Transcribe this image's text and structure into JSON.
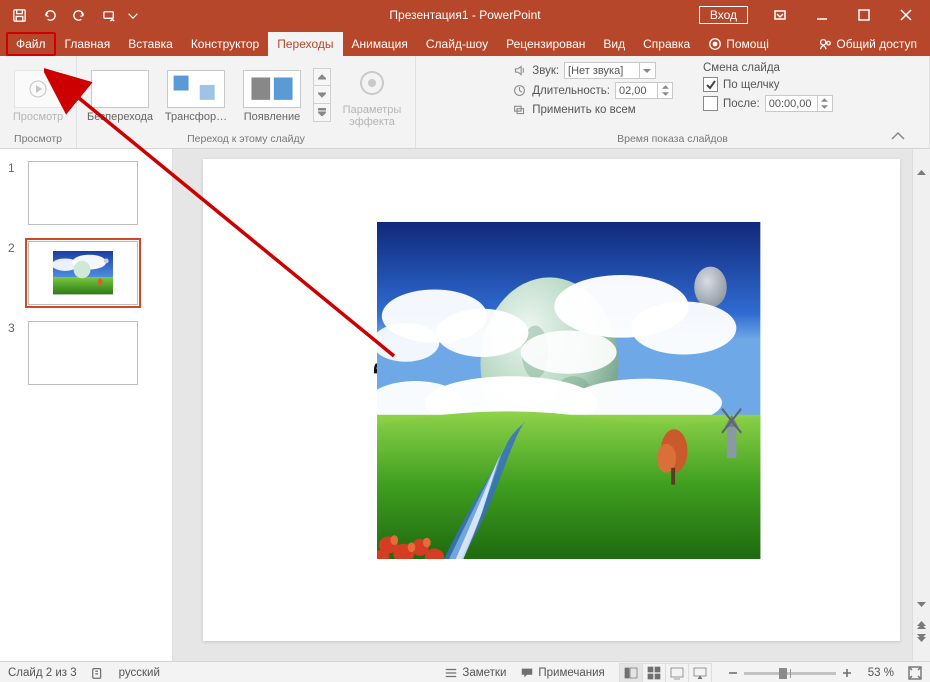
{
  "title": "Презентация1 - PowerPoint",
  "login": "Вход",
  "tabs": {
    "file": "Файл",
    "home": "Главная",
    "insert": "Вставка",
    "design": "Конструктор",
    "transitions": "Переходы",
    "animations": "Анимация",
    "slideshow": "Слайд-шоу",
    "review": "Рецензирован",
    "view": "Вид",
    "help": "Справка",
    "tellme": "Помощі",
    "share": "Общий доступ"
  },
  "ribbon": {
    "preview_group": "Просмотр",
    "preview_btn": "Просмотр",
    "gallery": {
      "none": "Безперехода",
      "morph": "Трансфор…",
      "fade": "Появление",
      "group_label": "Переход к этому слайду"
    },
    "effect_options": "Параметры\nэффекта",
    "timing": {
      "sound_label": "Звук:",
      "sound_value": "[Нет звука]",
      "duration_label": "Длительность:",
      "duration_value": "02,00",
      "apply_all": "Применить ко всем",
      "advance_header": "Смена слайда",
      "on_click": "По щелчку",
      "after_label": "После:",
      "after_value": "00:00,00",
      "group_label": "Время показа слайдов"
    }
  },
  "slides": [
    {
      "num": "1"
    },
    {
      "num": "2"
    },
    {
      "num": "3"
    }
  ],
  "status": {
    "slide_pos": "Слайд 2 из 3",
    "language": "русский",
    "notes": "Заметки",
    "comments": "Примечания",
    "zoom_value": "53 %"
  },
  "zoom_thumb_left": "38%"
}
